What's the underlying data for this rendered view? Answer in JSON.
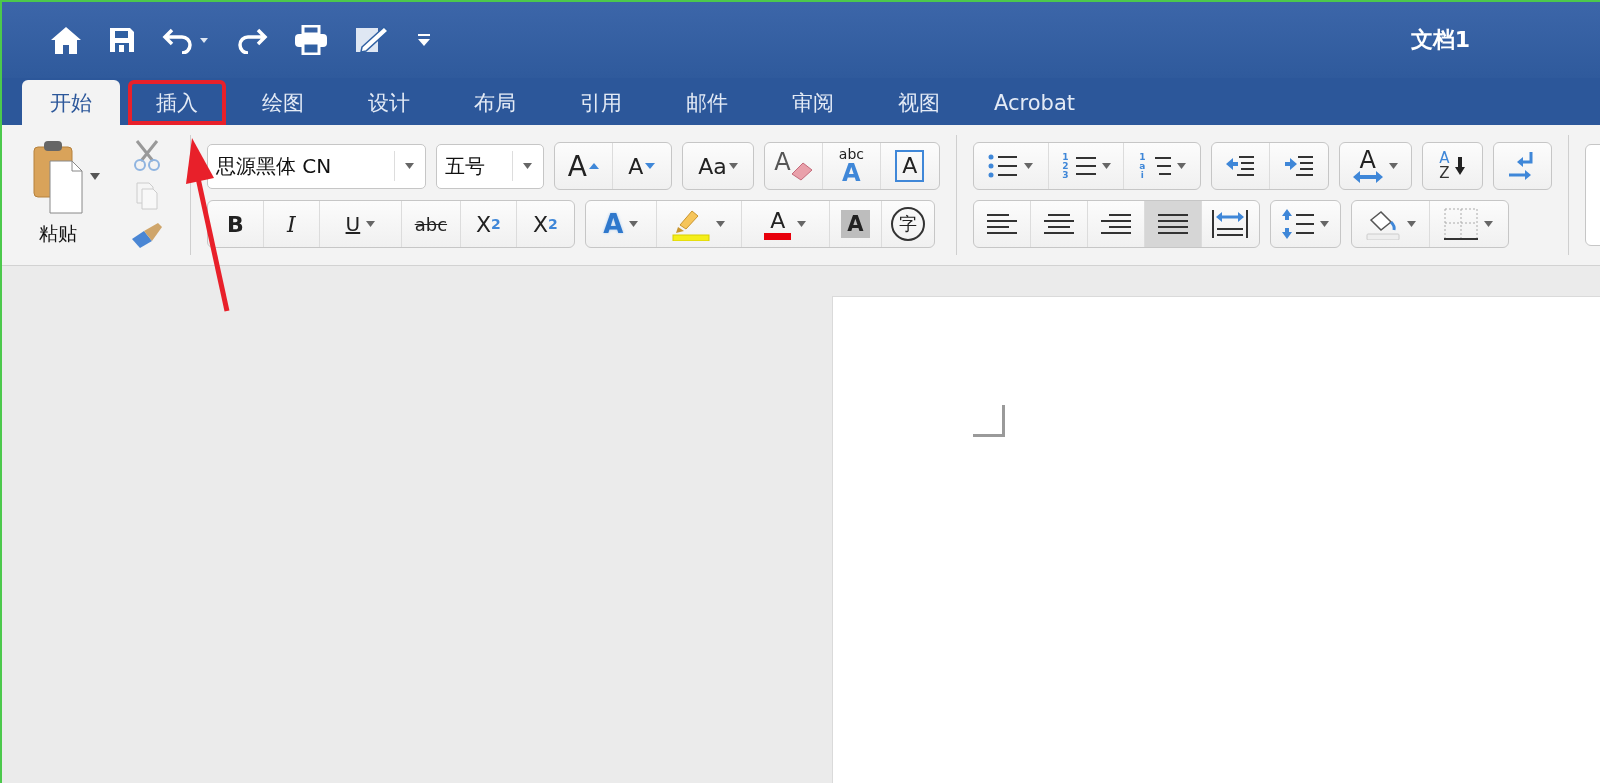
{
  "title": "文档1",
  "tabs": [
    {
      "label": "开始",
      "selected": true,
      "highlighted": false
    },
    {
      "label": "插入",
      "selected": false,
      "highlighted": true
    },
    {
      "label": "绘图",
      "selected": false,
      "highlighted": false
    },
    {
      "label": "设计",
      "selected": false,
      "highlighted": false
    },
    {
      "label": "布局",
      "selected": false,
      "highlighted": false
    },
    {
      "label": "引用",
      "selected": false,
      "highlighted": false
    },
    {
      "label": "邮件",
      "selected": false,
      "highlighted": false
    },
    {
      "label": "审阅",
      "selected": false,
      "highlighted": false
    },
    {
      "label": "视图",
      "selected": false,
      "highlighted": false
    },
    {
      "label": "Acrobat",
      "selected": false,
      "highlighted": false
    }
  ],
  "paste": {
    "label": "粘贴"
  },
  "font": {
    "name": "思源黑体 CN",
    "size": "五号"
  },
  "glyphs": {
    "grow": "A",
    "shrink": "A",
    "change_case": "Aa",
    "clear": "A",
    "phonetic_top": "abc",
    "phonetic_bottom": "A",
    "border": "A",
    "bold": "B",
    "italic": "I",
    "underline": "U",
    "strike": "abc",
    "sub": "X",
    "sub_index": "2",
    "sup": "X",
    "sup_index": "2",
    "effects": "A",
    "font_color": "A",
    "shading": "A",
    "enclosed": "字",
    "numbers": "123",
    "levels": "1ai",
    "asian": "A",
    "sort_top": "A",
    "sort_bottom": "Z"
  },
  "alignment": [
    {
      "kind": "left",
      "selected": false
    },
    {
      "kind": "center",
      "selected": false
    },
    {
      "kind": "right",
      "selected": false
    },
    {
      "kind": "justify",
      "selected": true
    },
    {
      "kind": "distributed",
      "selected": false
    }
  ]
}
